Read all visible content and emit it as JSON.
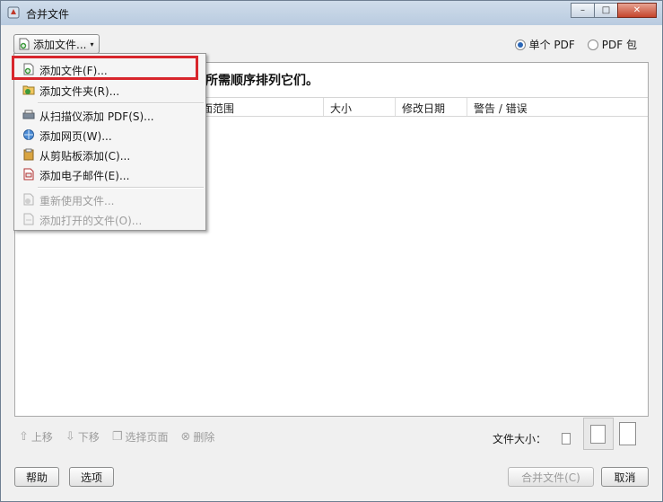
{
  "window": {
    "title": "合并文件",
    "min": "–",
    "max": "□",
    "close": "✕"
  },
  "toolbar": {
    "add_files_label": "添加文件...",
    "caret": "▾"
  },
  "output_mode": {
    "single_pdf": "单个 PDF",
    "pdf_package": "PDF 包",
    "selected": "single_pdf"
  },
  "instruction_text": "所需顺序排列它们。",
  "table": {
    "headers": [
      "面范围",
      "大小",
      "修改日期",
      "警告 / 错误"
    ]
  },
  "menu": {
    "items": [
      {
        "label": "添加文件(F)...",
        "icon": "add-file-icon",
        "enabled": true
      },
      {
        "label": "添加文件夹(R)...",
        "icon": "add-folder-icon",
        "enabled": true
      },
      {
        "label": "从扫描仪添加 PDF(S)...",
        "icon": "scanner-icon",
        "enabled": true
      },
      {
        "label": "添加网页(W)...",
        "icon": "web-page-icon",
        "enabled": true
      },
      {
        "label": "从剪贴板添加(C)...",
        "icon": "clipboard-icon",
        "enabled": true
      },
      {
        "label": "添加电子邮件(E)...",
        "icon": "email-icon",
        "enabled": true
      },
      {
        "label": "重新使用文件...",
        "icon": "reuse-files-icon",
        "enabled": false
      },
      {
        "label": "添加打开的文件(O)...",
        "icon": "open-files-icon",
        "enabled": false
      }
    ]
  },
  "bottom_toolbar": {
    "move_up": "上移",
    "move_down": "下移",
    "choose_pages": "选择页面",
    "delete": "删除"
  },
  "file_size_label": "文件大小：",
  "footer": {
    "help": "帮助",
    "options": "选项",
    "combine": "合并文件(C)",
    "cancel": "取消"
  },
  "colors": {
    "highlight": "#d8262c",
    "accent": "#2a66b6"
  }
}
